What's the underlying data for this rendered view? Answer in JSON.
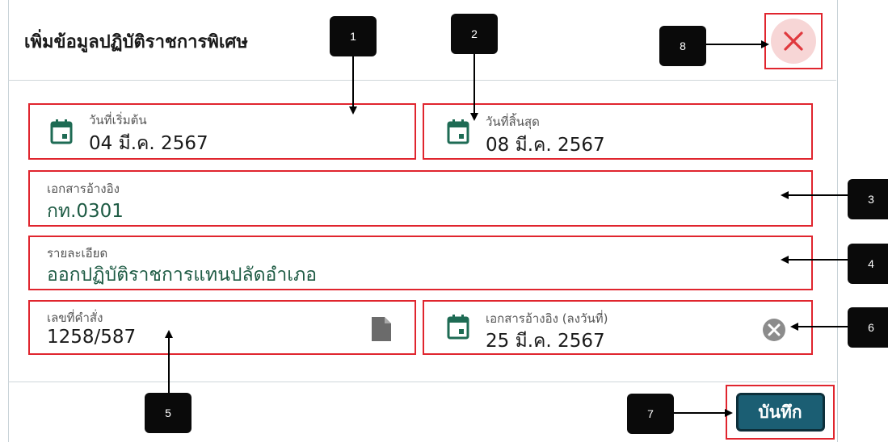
{
  "dialog": {
    "title": "เพิ่มข้อมูลปฏิบัติราชการพิเศษ",
    "close_icon": "close-x-icon"
  },
  "fields": {
    "start_date": {
      "label": "วันที่เริ่มต้น",
      "value": "04 มี.ค. 2567",
      "icon": "calendar-icon"
    },
    "end_date": {
      "label": "วันที่สิ้นสุด",
      "value": "08 มี.ค. 2567",
      "icon": "calendar-icon"
    },
    "reference_doc": {
      "label": "เอกสารอ้างอิง",
      "value": "กท.0301"
    },
    "details": {
      "label": "รายละเอียด",
      "value": "ออกปฏิบัติราชการแทนปลัดอำเภอ"
    },
    "order_number": {
      "label": "เลขที่คำสั่ง",
      "value": "1258/587",
      "icon": "file-icon"
    },
    "reference_date": {
      "label": "เอกสารอ้างอิง (ลงวันที่)",
      "value": "25 มี.ค. 2567",
      "icon": "calendar-icon",
      "clear_icon": "clear-circle-icon"
    }
  },
  "footer": {
    "save_label": "บันทึก"
  },
  "callouts": [
    "1",
    "2",
    "3",
    "4",
    "5",
    "6",
    "7",
    "8"
  ],
  "colors": {
    "annotation_border": "#e0252e",
    "icon_green": "#1e6b54",
    "save_button": "#1b5e73",
    "close_bg": "#f7d6d6",
    "close_x": "#e0393e"
  }
}
